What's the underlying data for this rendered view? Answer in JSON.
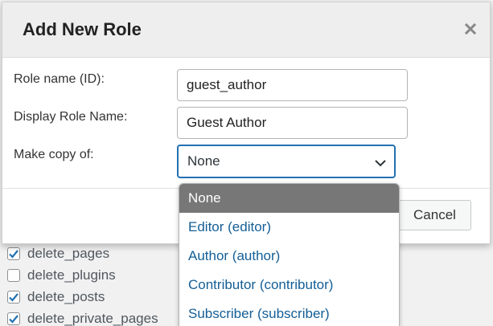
{
  "capabilities": [
    {
      "label": "delete_pages",
      "checked": true
    },
    {
      "label": "delete_plugins",
      "checked": false
    },
    {
      "label": "delete_posts",
      "checked": true
    },
    {
      "label": "delete_private_pages",
      "checked": true
    }
  ],
  "modal": {
    "title": "Add New Role",
    "close_icon": "close-icon",
    "fields": {
      "role_name_label": "Role name (ID):",
      "role_name_value": "guest_author",
      "display_name_label": "Display Role Name:",
      "display_name_value": "Guest Author",
      "copy_label": "Make copy of:",
      "copy_selected": "None"
    },
    "cancel_label": "Cancel"
  },
  "dropdown": {
    "options": [
      "None",
      "Editor (editor)",
      "Author (author)",
      "Contributor (contributor)",
      "Subscriber (subscriber)"
    ],
    "selected_index": 0
  },
  "colors": {
    "accent": "#2271b1",
    "option_text": "#135e96",
    "selected_bg": "#777777",
    "check": "#2271b1"
  }
}
